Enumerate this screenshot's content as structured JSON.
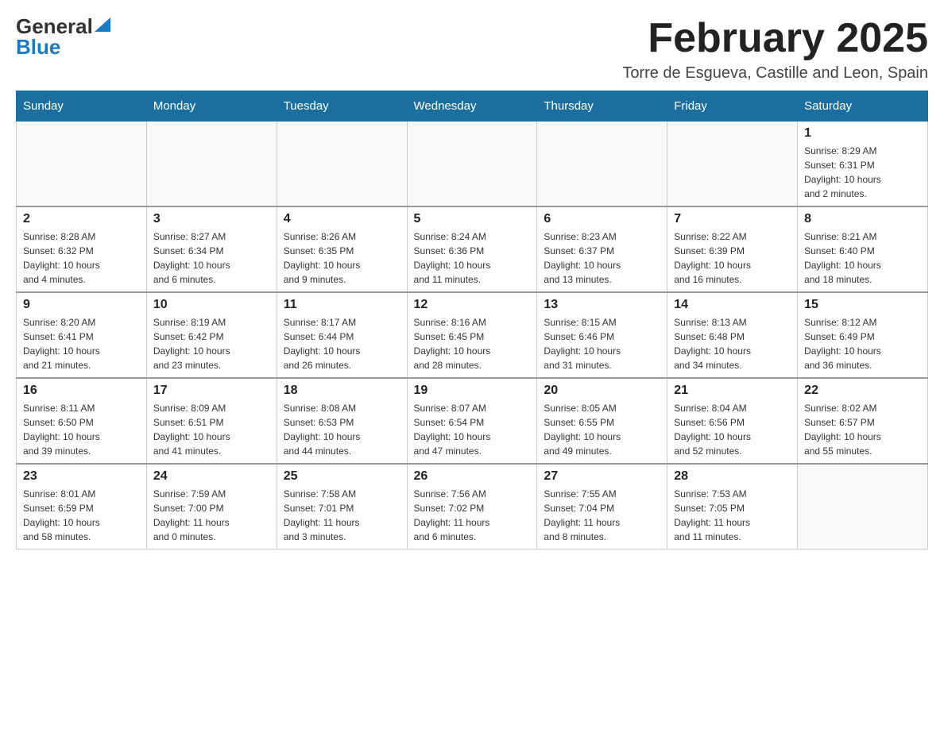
{
  "logo": {
    "general": "General",
    "blue": "Blue"
  },
  "header": {
    "title": "February 2025",
    "subtitle": "Torre de Esgueva, Castille and Leon, Spain"
  },
  "weekdays": [
    "Sunday",
    "Monday",
    "Tuesday",
    "Wednesday",
    "Thursday",
    "Friday",
    "Saturday"
  ],
  "weeks": [
    [
      {
        "day": "",
        "info": ""
      },
      {
        "day": "",
        "info": ""
      },
      {
        "day": "",
        "info": ""
      },
      {
        "day": "",
        "info": ""
      },
      {
        "day": "",
        "info": ""
      },
      {
        "day": "",
        "info": ""
      },
      {
        "day": "1",
        "info": "Sunrise: 8:29 AM\nSunset: 6:31 PM\nDaylight: 10 hours\nand 2 minutes."
      }
    ],
    [
      {
        "day": "2",
        "info": "Sunrise: 8:28 AM\nSunset: 6:32 PM\nDaylight: 10 hours\nand 4 minutes."
      },
      {
        "day": "3",
        "info": "Sunrise: 8:27 AM\nSunset: 6:34 PM\nDaylight: 10 hours\nand 6 minutes."
      },
      {
        "day": "4",
        "info": "Sunrise: 8:26 AM\nSunset: 6:35 PM\nDaylight: 10 hours\nand 9 minutes."
      },
      {
        "day": "5",
        "info": "Sunrise: 8:24 AM\nSunset: 6:36 PM\nDaylight: 10 hours\nand 11 minutes."
      },
      {
        "day": "6",
        "info": "Sunrise: 8:23 AM\nSunset: 6:37 PM\nDaylight: 10 hours\nand 13 minutes."
      },
      {
        "day": "7",
        "info": "Sunrise: 8:22 AM\nSunset: 6:39 PM\nDaylight: 10 hours\nand 16 minutes."
      },
      {
        "day": "8",
        "info": "Sunrise: 8:21 AM\nSunset: 6:40 PM\nDaylight: 10 hours\nand 18 minutes."
      }
    ],
    [
      {
        "day": "9",
        "info": "Sunrise: 8:20 AM\nSunset: 6:41 PM\nDaylight: 10 hours\nand 21 minutes."
      },
      {
        "day": "10",
        "info": "Sunrise: 8:19 AM\nSunset: 6:42 PM\nDaylight: 10 hours\nand 23 minutes."
      },
      {
        "day": "11",
        "info": "Sunrise: 8:17 AM\nSunset: 6:44 PM\nDaylight: 10 hours\nand 26 minutes."
      },
      {
        "day": "12",
        "info": "Sunrise: 8:16 AM\nSunset: 6:45 PM\nDaylight: 10 hours\nand 28 minutes."
      },
      {
        "day": "13",
        "info": "Sunrise: 8:15 AM\nSunset: 6:46 PM\nDaylight: 10 hours\nand 31 minutes."
      },
      {
        "day": "14",
        "info": "Sunrise: 8:13 AM\nSunset: 6:48 PM\nDaylight: 10 hours\nand 34 minutes."
      },
      {
        "day": "15",
        "info": "Sunrise: 8:12 AM\nSunset: 6:49 PM\nDaylight: 10 hours\nand 36 minutes."
      }
    ],
    [
      {
        "day": "16",
        "info": "Sunrise: 8:11 AM\nSunset: 6:50 PM\nDaylight: 10 hours\nand 39 minutes."
      },
      {
        "day": "17",
        "info": "Sunrise: 8:09 AM\nSunset: 6:51 PM\nDaylight: 10 hours\nand 41 minutes."
      },
      {
        "day": "18",
        "info": "Sunrise: 8:08 AM\nSunset: 6:53 PM\nDaylight: 10 hours\nand 44 minutes."
      },
      {
        "day": "19",
        "info": "Sunrise: 8:07 AM\nSunset: 6:54 PM\nDaylight: 10 hours\nand 47 minutes."
      },
      {
        "day": "20",
        "info": "Sunrise: 8:05 AM\nSunset: 6:55 PM\nDaylight: 10 hours\nand 49 minutes."
      },
      {
        "day": "21",
        "info": "Sunrise: 8:04 AM\nSunset: 6:56 PM\nDaylight: 10 hours\nand 52 minutes."
      },
      {
        "day": "22",
        "info": "Sunrise: 8:02 AM\nSunset: 6:57 PM\nDaylight: 10 hours\nand 55 minutes."
      }
    ],
    [
      {
        "day": "23",
        "info": "Sunrise: 8:01 AM\nSunset: 6:59 PM\nDaylight: 10 hours\nand 58 minutes."
      },
      {
        "day": "24",
        "info": "Sunrise: 7:59 AM\nSunset: 7:00 PM\nDaylight: 11 hours\nand 0 minutes."
      },
      {
        "day": "25",
        "info": "Sunrise: 7:58 AM\nSunset: 7:01 PM\nDaylight: 11 hours\nand 3 minutes."
      },
      {
        "day": "26",
        "info": "Sunrise: 7:56 AM\nSunset: 7:02 PM\nDaylight: 11 hours\nand 6 minutes."
      },
      {
        "day": "27",
        "info": "Sunrise: 7:55 AM\nSunset: 7:04 PM\nDaylight: 11 hours\nand 8 minutes."
      },
      {
        "day": "28",
        "info": "Sunrise: 7:53 AM\nSunset: 7:05 PM\nDaylight: 11 hours\nand 11 minutes."
      },
      {
        "day": "",
        "info": ""
      }
    ]
  ]
}
